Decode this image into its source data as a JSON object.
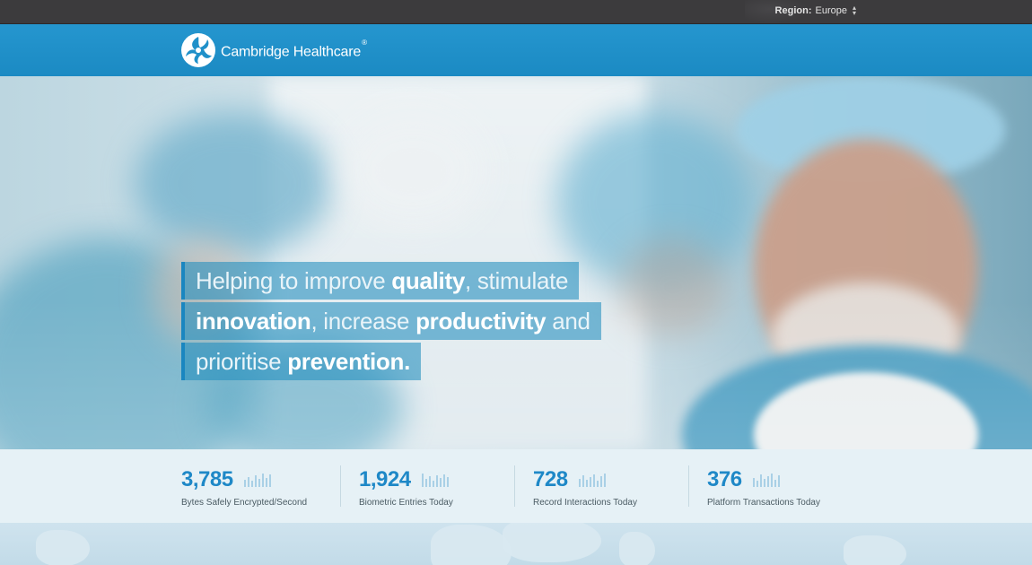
{
  "topbar": {
    "region_label": "Region:",
    "region_value": "Europe",
    "selector_icon": "up-down-arrows-icon"
  },
  "header": {
    "brand": "Cambridge Healthcare",
    "registered_mark": "®",
    "logo_icon": "swirl-logo-icon",
    "colors": {
      "bar": "#1f90c9",
      "topbar": "#3c3b3d"
    }
  },
  "hero": {
    "headline_lines": [
      {
        "parts": [
          {
            "text": "Helping to improve ",
            "bold": false
          },
          {
            "text": "quality",
            "bold": true
          },
          {
            "text": ", stimulate",
            "bold": false
          }
        ]
      },
      {
        "parts": [
          {
            "text": "innovation",
            "bold": true
          },
          {
            "text": ", increase ",
            "bold": false
          },
          {
            "text": "productivity",
            "bold": true
          },
          {
            "text": " and",
            "bold": false
          }
        ]
      },
      {
        "parts": [
          {
            "text": "prioritise ",
            "bold": false
          },
          {
            "text": "prevention.",
            "bold": true
          }
        ]
      }
    ]
  },
  "stats": [
    {
      "value": "3,785",
      "label": "Bytes Safely Encrypted/Second",
      "icon": "bar-chart-icon"
    },
    {
      "value": "1,924",
      "label": "Biometric Entries Today",
      "icon": "bar-chart-icon"
    },
    {
      "value": "728",
      "label": "Record Interactions Today",
      "icon": "bar-chart-icon"
    },
    {
      "value": "376",
      "label": "Platform Transactions Today",
      "icon": "bar-chart-icon"
    }
  ],
  "accent_color": "#1e88c7"
}
